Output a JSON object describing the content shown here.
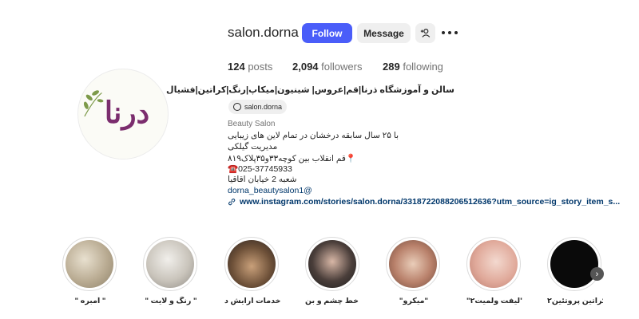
{
  "profile": {
    "username": "salon.dorna",
    "follow_label": "Follow",
    "message_label": "Message",
    "logo_text": "درنا"
  },
  "stats": {
    "posts_count": "124",
    "posts_label": "posts",
    "followers_count": "2,094",
    "followers_label": "followers",
    "following_count": "289",
    "following_label": "following"
  },
  "bio": {
    "name": "سالن و آموزشگاه ذرنا|قم|عروس| شینیون|میکاپ|رنگ|کراتین|فشیال",
    "threads_handle": "salon.dorna",
    "category": "Beauty Salon",
    "lines": [
      "با ۲۵ سال سابقه درخشان در تمام لاین های زیبایی",
      "مدیریت گیلکی",
      "📍قم انقلاب بین کوچه۳۳و۳۵پلاک۸۱۹",
      "☎️025-37745933",
      "شعبه 2 خیابان اقاقیا"
    ],
    "mention": "dorna_beautysalon1@",
    "external_link": "www.instagram.com/stories/salon.dorna/3318722088206512636?utm_source=ig_story_item_s..."
  },
  "highlights": [
    {
      "label": "\" آمبره \""
    },
    {
      "label": "\" رنگ و لایت \""
    },
    {
      "label": "خدمات آرایش د..."
    },
    {
      "label": "خط چشم و بن ..."
    },
    {
      "label": "\"میکرو\""
    },
    {
      "label": "\"لیفت ولمیت۲\""
    },
    {
      "label": "کراتین پروتئین۲"
    }
  ],
  "colors": {
    "follow_button": "#4a5df9",
    "logo_purple": "#7b2d6e",
    "logo_leaf": "#7d9a4a"
  },
  "icons": {
    "suggest": "add-person-icon",
    "more": "more-dots-icon",
    "threads": "threads-icon",
    "link": "link-icon",
    "next": "chevron-right-icon"
  }
}
